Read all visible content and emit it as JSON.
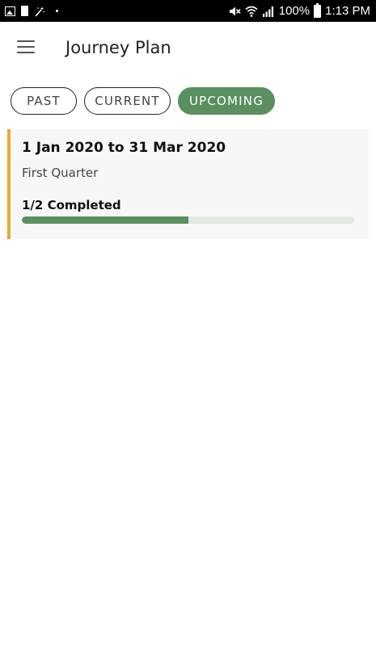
{
  "status_bar": {
    "left_icons": [
      "gallery-icon",
      "sim-card-icon",
      "magic-wand-icon",
      "notification-dot-icon"
    ],
    "right_icons": [
      "mute-icon",
      "wifi-icon",
      "signal-icon",
      "battery-icon"
    ],
    "battery": "100%",
    "time": "1:13 PM"
  },
  "header": {
    "menu_icon": "hamburger-menu-icon",
    "title": "Journey Plan"
  },
  "tabs": [
    {
      "label": "PAST",
      "selected": false
    },
    {
      "label": "CURRENT",
      "selected": false
    },
    {
      "label": "UPCOMING",
      "selected": true
    }
  ],
  "plans": [
    {
      "date_range": "1 Jan 2020 to 31 Mar 2020",
      "name": "First Quarter",
      "progress_label": "1/2 Completed",
      "progress_fraction": 0.5
    }
  ],
  "colors": {
    "accent_green": "#5a8f5f",
    "card_border": "#e9a92c",
    "card_background": "#f7f7f7",
    "progress_track": "#e4e9e4"
  }
}
